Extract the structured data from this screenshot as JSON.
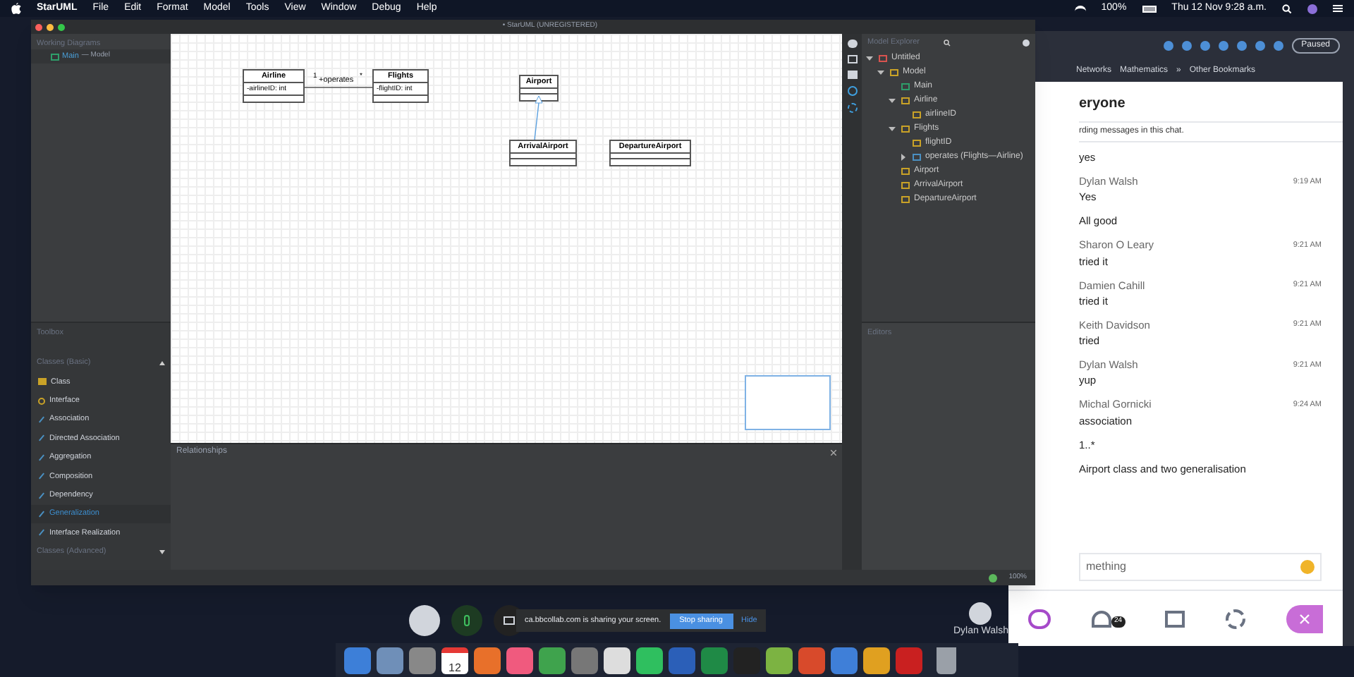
{
  "menu_bar": {
    "app": "StarUML",
    "items": [
      "File",
      "Edit",
      "Format",
      "Model",
      "Tools",
      "View",
      "Window",
      "Debug",
      "Help"
    ],
    "battery": "100%",
    "clock": "Thu 12 Nov  9:28 a.m."
  },
  "window": {
    "title": "• StarUML (UNREGISTERED)"
  },
  "working_diagrams": {
    "title": "Working Diagrams",
    "items": [
      {
        "label": "Main",
        "context": "— Model",
        "selected": true
      }
    ]
  },
  "toolbox": {
    "title": "Toolbox",
    "groups": [
      {
        "title": "Classes (Basic)",
        "expanded": true,
        "items": [
          {
            "label": "Class",
            "kind": "class",
            "selected": false
          },
          {
            "label": "Interface",
            "kind": "interface",
            "selected": false
          },
          {
            "label": "Association",
            "kind": "relation",
            "selected": false
          },
          {
            "label": "Directed Association",
            "kind": "relation",
            "selected": false
          },
          {
            "label": "Aggregation",
            "kind": "relation",
            "selected": false
          },
          {
            "label": "Composition",
            "kind": "relation",
            "selected": false
          },
          {
            "label": "Dependency",
            "kind": "relation",
            "selected": false
          },
          {
            "label": "Generalization",
            "kind": "relation",
            "selected": true
          },
          {
            "label": "Interface Realization",
            "kind": "relation",
            "selected": false
          }
        ]
      },
      {
        "title": "Classes (Advanced)",
        "expanded": false
      }
    ]
  },
  "diagram": {
    "classes": [
      {
        "name": "Airline",
        "attributes": [
          "-airlineID: int"
        ]
      },
      {
        "name": "Flights",
        "attributes": [
          "-flightID: int"
        ]
      },
      {
        "name": "Airport"
      },
      {
        "name": "ArrivalAirport"
      },
      {
        "name": "DepartureAirport"
      }
    ],
    "connectors": [
      {
        "kind": "association",
        "label": "+operates",
        "end_a": "1",
        "end_b": "*"
      },
      {
        "kind": "generalization"
      }
    ]
  },
  "relationships_panel": {
    "title": "Relationships"
  },
  "model_explorer": {
    "title": "Model Explorer",
    "tree": [
      {
        "label": "Untitled",
        "kind": "project",
        "expanded": true,
        "children": [
          {
            "label": "Model",
            "kind": "model",
            "expanded": true,
            "children": [
              {
                "label": "Main",
                "kind": "diagram"
              },
              {
                "label": "Airline",
                "kind": "class",
                "expanded": true,
                "children": [
                  {
                    "label": "airlineID",
                    "kind": "attribute"
                  }
                ]
              },
              {
                "label": "Flights",
                "kind": "class",
                "expanded": true,
                "children": [
                  {
                    "label": "flightID",
                    "kind": "attribute"
                  },
                  {
                    "label": "operates (Flights—Airline)",
                    "kind": "association",
                    "expanded": false
                  }
                ]
              },
              {
                "label": "Airport",
                "kind": "class"
              },
              {
                "label": "ArrivalAirport",
                "kind": "class"
              },
              {
                "label": "DepartureAirport",
                "kind": "class"
              }
            ]
          }
        ]
      }
    ]
  },
  "editors_panel": {
    "title": "Editors"
  },
  "status_bar": {
    "zoom": "100%"
  },
  "browser": {
    "extension_status": "Paused",
    "bookmarks": [
      "Networks",
      "Mathematics",
      "»",
      "Other Bookmarks"
    ]
  },
  "chat": {
    "title": "eryone",
    "notice": "rding messages in this chat.",
    "messages": [
      {
        "text": "yes"
      },
      {
        "author": "Dylan Walsh",
        "time": "9:19 AM",
        "text": "Yes"
      },
      {
        "text": "All good"
      },
      {
        "author": "Sharon O Leary",
        "time": "9:21 AM",
        "text": "tried it"
      },
      {
        "author": "Damien Cahill",
        "time": "9:21 AM",
        "text": "tried it"
      },
      {
        "author": "Keith Davidson",
        "time": "9:21 AM",
        "text": "tried"
      },
      {
        "author": "Dylan Walsh",
        "time": "9:21 AM",
        "text": "yup"
      },
      {
        "author": "Michal Gornicki",
        "time": "9:24 AM",
        "text": "association"
      },
      {
        "text": "1..*"
      },
      {
        "text": "Airport class and two generalisation"
      }
    ],
    "input_placeholder": "mething",
    "participants_count": "24"
  },
  "sharing_bar": {
    "message": "ca.bbcollab.com is sharing your screen.",
    "stop_button": "Stop sharing",
    "hide_button": "Hide",
    "presenter": "Dylan Walsh"
  },
  "dock": {
    "calendar_day": "12"
  }
}
